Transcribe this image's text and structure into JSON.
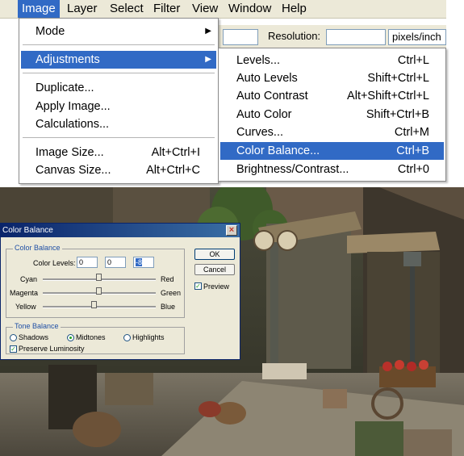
{
  "menubar": {
    "items": [
      "Image",
      "Layer",
      "Select",
      "Filter",
      "View",
      "Window",
      "Help"
    ]
  },
  "options_bar": {
    "resolution_label": "Resolution:",
    "resolution_unit": "pixels/inch"
  },
  "image_menu": {
    "mode": "Mode",
    "adjustments": "Adjustments",
    "duplicate": "Duplicate...",
    "apply_image": "Apply Image...",
    "calculations": "Calculations...",
    "image_size": "Image Size...",
    "image_size_shortcut": "Alt+Ctrl+I",
    "canvas_size": "Canvas Size...",
    "canvas_size_shortcut": "Alt+Ctrl+C"
  },
  "adjustments_menu": {
    "items": [
      {
        "label": "Levels...",
        "shortcut": "Ctrl+L"
      },
      {
        "label": "Auto Levels",
        "shortcut": "Shift+Ctrl+L"
      },
      {
        "label": "Auto Contrast",
        "shortcut": "Alt+Shift+Ctrl+L"
      },
      {
        "label": "Auto Color",
        "shortcut": "Shift+Ctrl+B"
      },
      {
        "label": "Curves...",
        "shortcut": "Ctrl+M"
      },
      {
        "label": "Color Balance...",
        "shortcut": "Ctrl+B"
      },
      {
        "label": "Brightness/Contrast...",
        "shortcut": "Ctrl+0"
      }
    ],
    "highlighted": "Color Balance..."
  },
  "dialog": {
    "title": "Color Balance",
    "color_balance_group": "Color Balance",
    "color_levels_label": "Color Levels:",
    "levels": [
      "0",
      "0",
      "-8"
    ],
    "sliders": [
      {
        "left": "Cyan",
        "right": "Red",
        "value": 0
      },
      {
        "left": "Magenta",
        "right": "Green",
        "value": 0
      },
      {
        "left": "Yellow",
        "right": "Blue",
        "value": -8
      }
    ],
    "ok_label": "OK",
    "cancel_label": "Cancel",
    "preview_label": "Preview",
    "preview_checked": true,
    "tone_balance_group": "Tone Balance",
    "tones": [
      "Shadows",
      "Midtones",
      "Highlights"
    ],
    "selected_tone": "Midtones",
    "preserve_luminosity_label": "Preserve Luminosity",
    "preserve_luminosity_checked": true
  },
  "colors": {
    "highlight": "#316ac5",
    "menubar_bg": "#ece9d8",
    "title_bar": "#0a246a"
  }
}
